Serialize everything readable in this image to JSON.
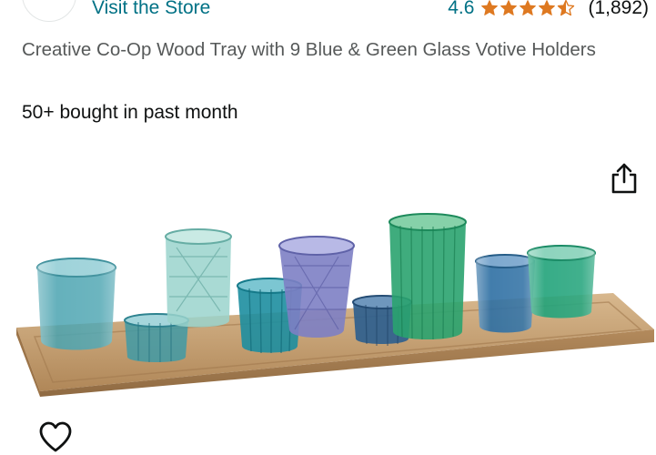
{
  "store": {
    "link_label": "Visit the Store"
  },
  "rating": {
    "value": "4.6",
    "stars": 4.6,
    "count": "(1,892)",
    "star_color": "#de7921"
  },
  "product": {
    "title": "Creative Co-Op Wood Tray with 9 Blue & Green Glass Votive Holders",
    "bought_text": "50+ bought in past month"
  },
  "icons": {
    "share": "share-icon",
    "favorite": "heart-outline-icon",
    "logo": "store-logo"
  },
  "colors": {
    "link": "#007185",
    "title_gray": "#565959",
    "text": "#0f1111"
  }
}
